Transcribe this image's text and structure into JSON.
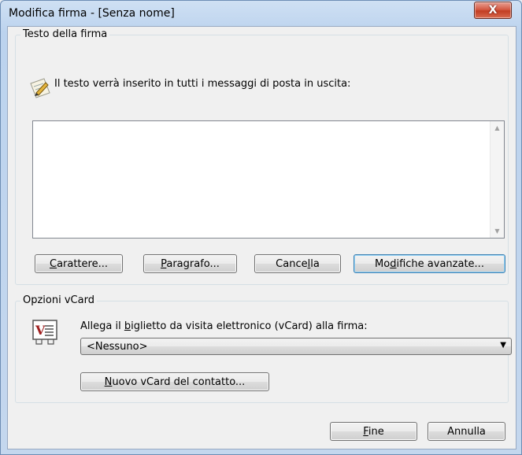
{
  "window": {
    "title": "Modifica firma - [Senza nome]",
    "close_symbol": "X"
  },
  "signature_group": {
    "label": "Testo della firma",
    "info_text": "Il testo verrà inserito in tutti i messaggi di posta in uscita:",
    "icon": "pen-paper-icon",
    "textarea_value": ""
  },
  "buttons": {
    "font_pre": "",
    "font_u": "C",
    "font_post": "arattere...",
    "para_pre": "",
    "para_u": "P",
    "para_post": "aragrafo...",
    "clear_pre": "Cance",
    "clear_u": "l",
    "clear_post": "la",
    "advanced_pre": "Mo",
    "advanced_u": "d",
    "advanced_post": "ifiche avanzate..."
  },
  "vcard_group": {
    "label": "Opzioni vCard",
    "attach_pre": "Allega il ",
    "attach_u": "b",
    "attach_post": "iglietto da visita elettronico (vCard) alla firma:",
    "icon": "vcard-icon",
    "selected": "<Nessuno>",
    "new_pre": "",
    "new_u": "N",
    "new_post": "uovo vCard del contatto..."
  },
  "footer": {
    "finish_pre": "",
    "finish_u": "F",
    "finish_post": "ine",
    "cancel_label": "Annulla"
  },
  "colors": {
    "accent": "#3c7fb1",
    "close": "#c23d23",
    "dialog_bg": "#f0f0f0"
  }
}
